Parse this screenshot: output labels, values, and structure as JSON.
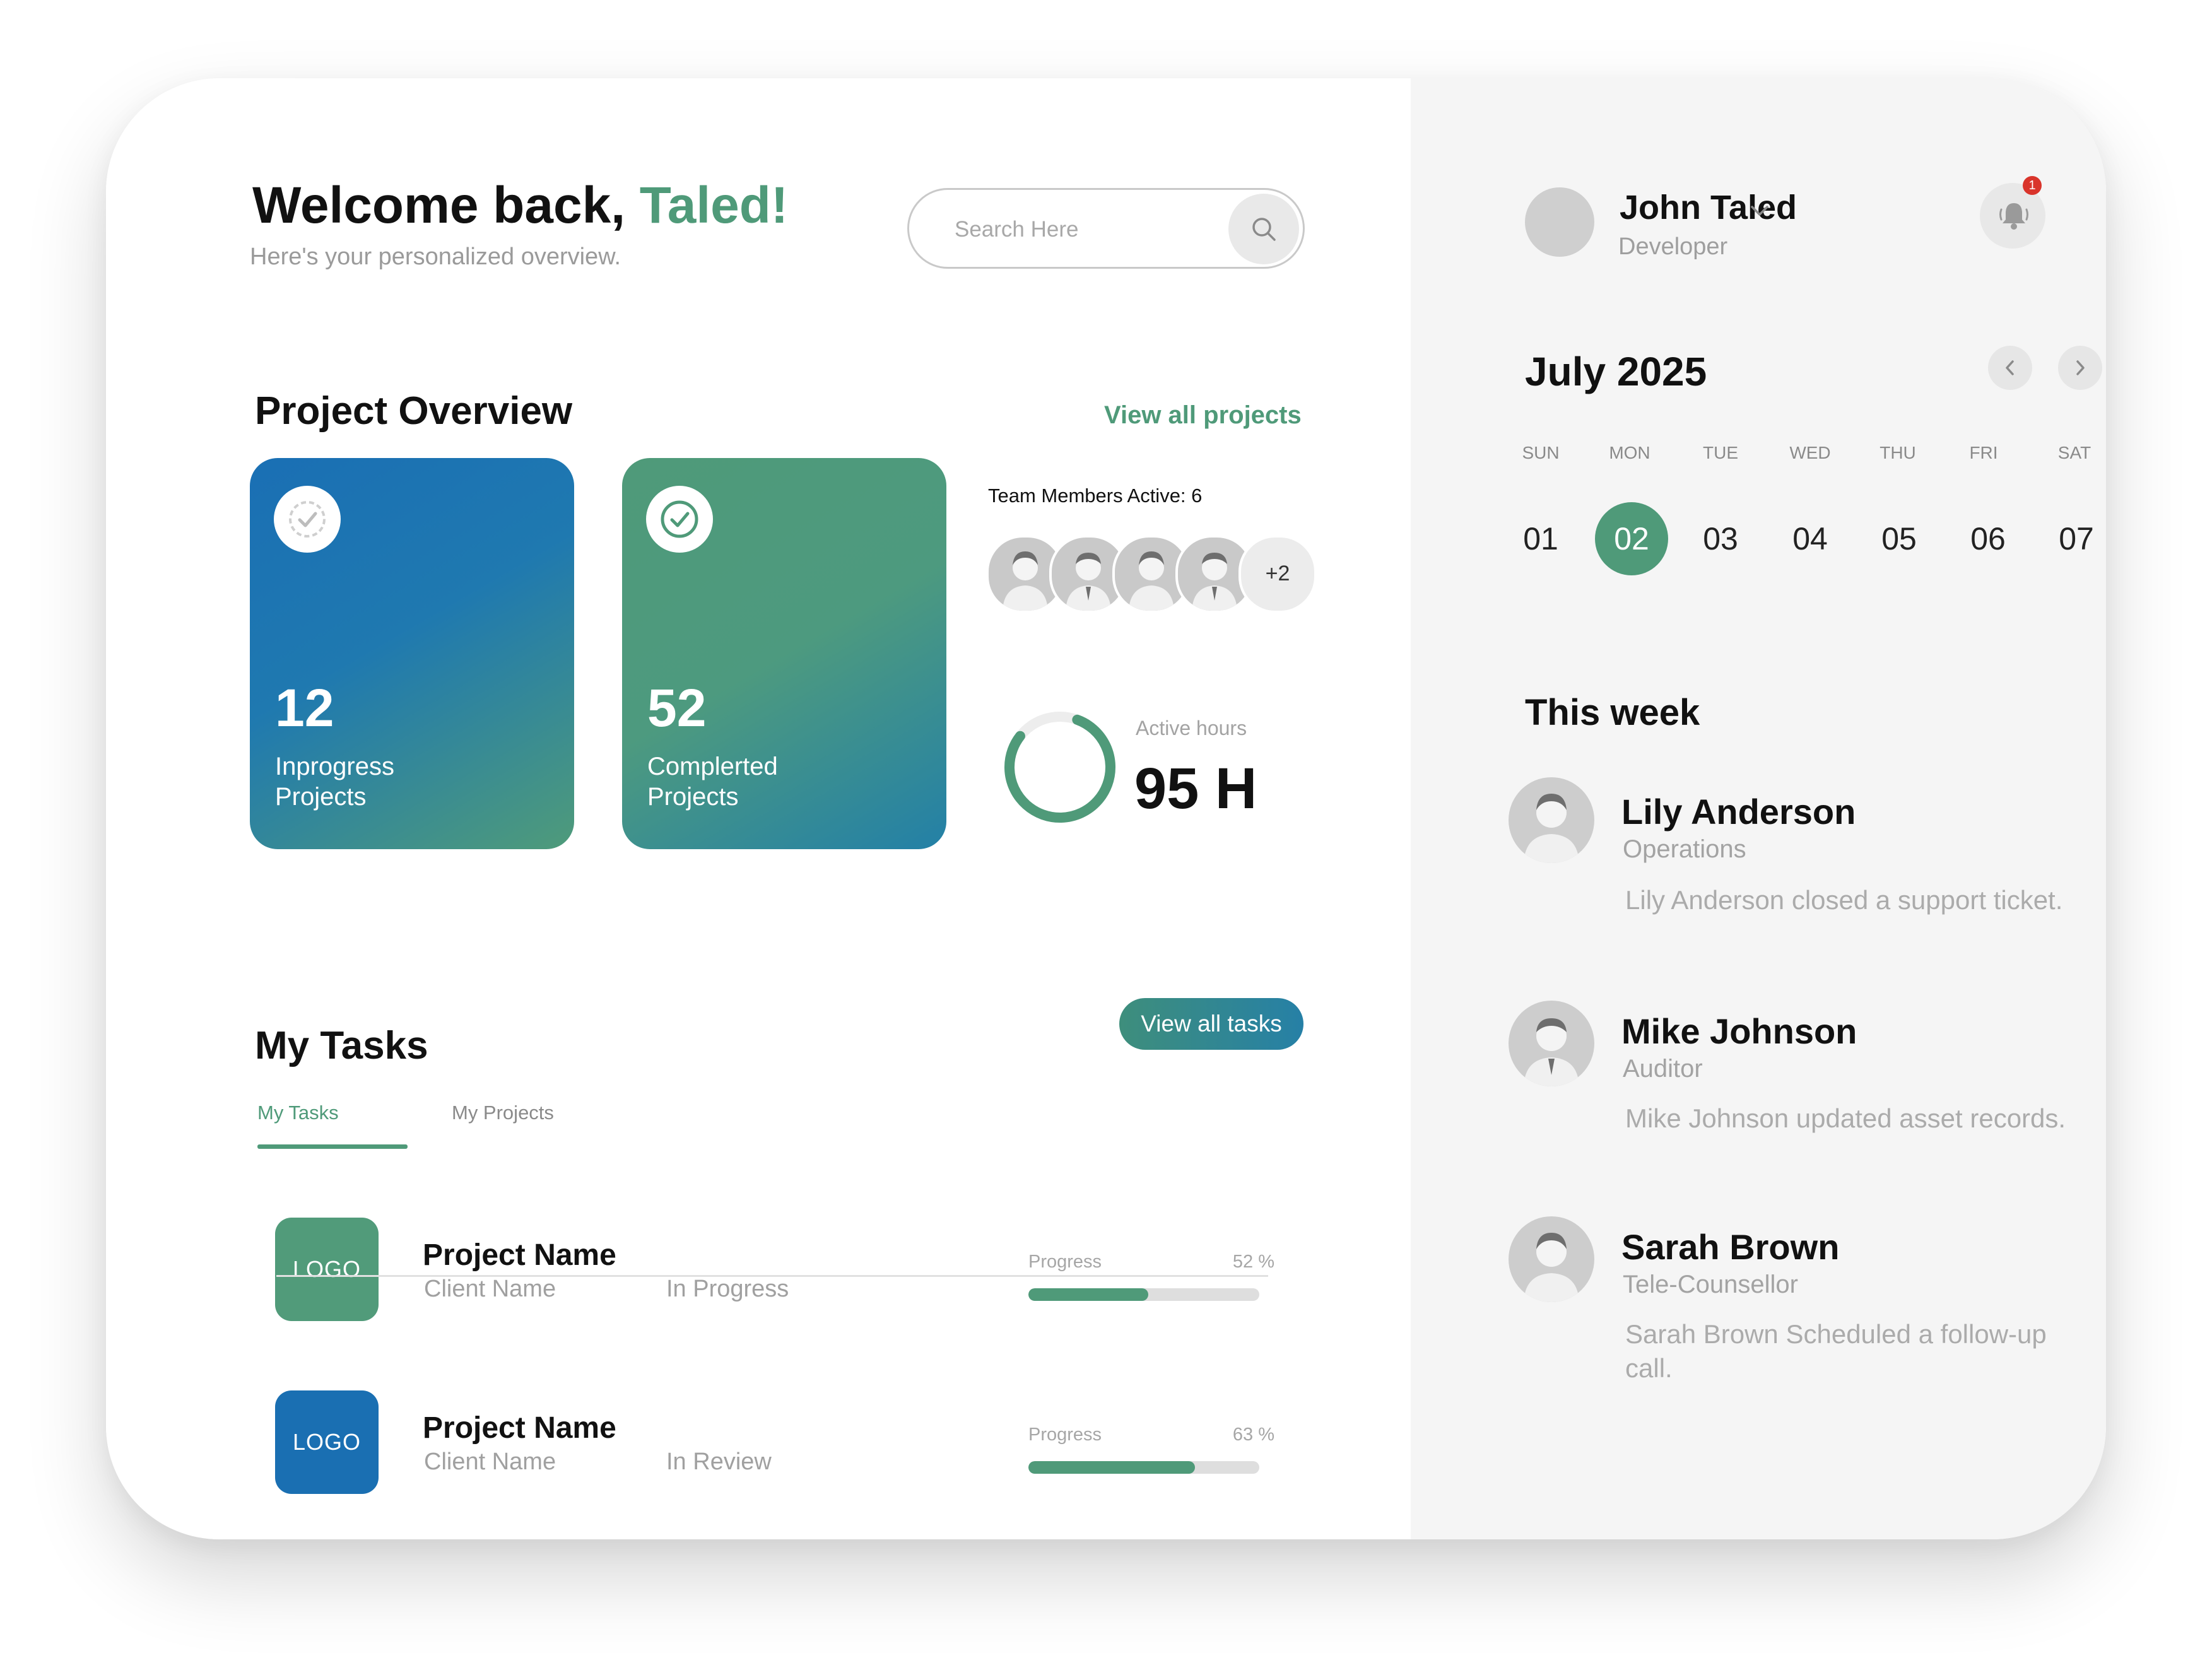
{
  "header": {
    "welcome_prefix": "Welcome back, ",
    "welcome_name": "Taled!",
    "subtitle": "Here's your personalized overview.",
    "search_placeholder": "Search Here"
  },
  "project_overview": {
    "title": "Project Overview",
    "view_all_label": "View all projects",
    "cards": [
      {
        "value": "12",
        "label_line1": "Inprogress",
        "label_line2": "Projects"
      },
      {
        "value": "52",
        "label_line1": "Complerted",
        "label_line2": "Projects"
      }
    ],
    "team_label": "Team Members Active: 6",
    "team_more": "+2",
    "active_hours_label": "Active hours",
    "active_hours_value": "95 H"
  },
  "tasks": {
    "title": "My Tasks",
    "tabs": [
      "My Tasks",
      "My Projects"
    ],
    "view_all_label": "View all tasks",
    "items": [
      {
        "logo": "LOGO",
        "name": "Project Name",
        "client": "Client Name",
        "status": "In Progress",
        "progress_label": "Progress",
        "progress_text": "52 %",
        "progress": 52
      },
      {
        "logo": "LOGO",
        "name": "Project Name",
        "client": "Client Name",
        "status": "In Review",
        "progress_label": "Progress",
        "progress_text": "63 %",
        "progress": 72
      }
    ]
  },
  "user": {
    "name": "John Taled",
    "role": "Developer",
    "notification_count": "1"
  },
  "calendar": {
    "month": "July 2025",
    "weekdays": [
      "SUN",
      "MON",
      "TUE",
      "WED",
      "THU",
      "FRI",
      "SAT"
    ],
    "days": [
      "01",
      "02",
      "03",
      "04",
      "05",
      "06",
      "07"
    ],
    "selected_day": "02"
  },
  "this_week": {
    "title": "This week",
    "activities": [
      {
        "name": "Lily Anderson",
        "role": "Operations",
        "description": "Lily Anderson closed a support ticket."
      },
      {
        "name": "Mike Johnson",
        "role": "Auditor",
        "description": "Mike Johnson updated asset records."
      },
      {
        "name": "Sarah Brown",
        "role": "Tele-Counsellor",
        "description": "Sarah Brown Scheduled a follow-up call."
      }
    ]
  },
  "colors": {
    "accent_green": "#4f9a79",
    "accent_blue": "#1a6fb2",
    "badge_red": "#d9342b"
  }
}
